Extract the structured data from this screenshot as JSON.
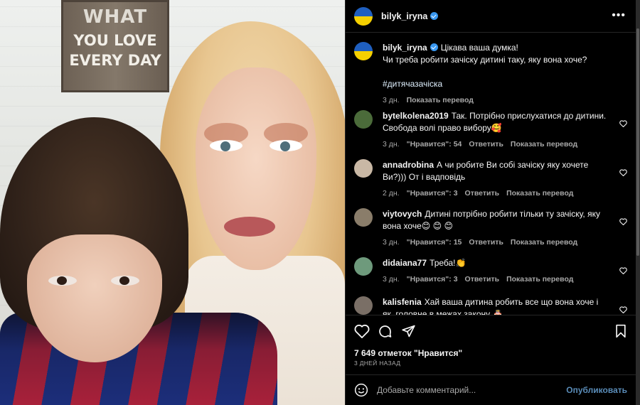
{
  "photo": {
    "sign_lines": [
      "WHAT",
      "YOU LOVE",
      "EVERY DAY"
    ]
  },
  "post": {
    "author": "bilyk_iryna",
    "more_label": "•••"
  },
  "caption": {
    "user": "bilyk_iryna",
    "text": "Цікава ваша думка!\nЧи треба робити зачіску дитині таку, яку вона хоче?",
    "hashtag": "#дитячазачіска",
    "time": "3 дн.",
    "translate": "Показать перевод"
  },
  "comments": [
    {
      "user": "bytelkolena2019",
      "text": "Так. Потрібно прислухатися до дитини. Свобода волі право вибору🥰",
      "time": "3 дн.",
      "likes": "\"Нравится\": 54",
      "reply": "Ответить",
      "translate": "Показать перевод",
      "avatar_color": "#4b6b3a"
    },
    {
      "user": "annadrobina",
      "text": "А чи робите Ви собі зачіску яку хочете Ви?))) От і вадповідь",
      "time": "2 дн.",
      "likes": "\"Нравится\": 3",
      "reply": "Ответить",
      "translate": "Показать перевод",
      "avatar_color": "#c9b8a5"
    },
    {
      "user": "viytovych",
      "text": "Дитині потрібно робити тільки ту зачіску, яку вона хоче😊 😊 😊",
      "time": "3 дн.",
      "likes": "\"Нравится\": 15",
      "reply": "Ответить",
      "translate": "Показать перевод",
      "avatar_color": "#8a7d6a"
    },
    {
      "user": "didaiana77",
      "text": "Треба!👏",
      "time": "3 дн.",
      "likes": "\"Нравится\": 3",
      "reply": "Ответить",
      "translate": "Показать перевод",
      "avatar_color": "#6e9a7c"
    },
    {
      "user": "kalisfenia",
      "text": "Хай ваша дитина робить все що вона хоче і як, головне в межах закону 🎂",
      "time": "",
      "likes": "",
      "reply": "",
      "translate": "",
      "avatar_color": "#7a6f66"
    }
  ],
  "actions": {
    "likes": "7 649 отметок \"Нравится\"",
    "ago": "3 ДНЕЙ НАЗАД"
  },
  "add_comment": {
    "placeholder": "Добавьте комментарий...",
    "publish": "Опубликовать"
  },
  "colors": {
    "background": "#000000",
    "verified": "#3897f0",
    "publish": "#5a8cb8"
  },
  "icons": [
    "more-icon",
    "heart-icon",
    "comment-icon",
    "share-icon",
    "bookmark-icon",
    "emoji-icon",
    "verified-icon"
  ]
}
